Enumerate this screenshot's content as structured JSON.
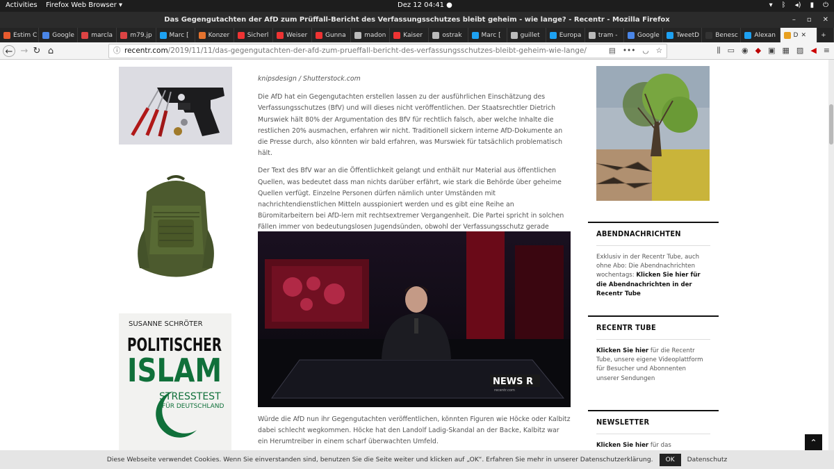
{
  "system": {
    "activities": "Activities",
    "app": "Firefox Web Browser ▾",
    "clock": "Dez 12  04:41 ●"
  },
  "window": {
    "title": "Das Gegengutachten der AfD zum Prüffall-Bericht des Verfassungsschutzes bleibt geheim - wie lange? - Recentr - Mozilla Firefox"
  },
  "tabs": [
    {
      "label": "Estim C",
      "color": "#e85a2e"
    },
    {
      "label": "Google",
      "color": "#4a86e8"
    },
    {
      "label": "marcla",
      "color": "#d44"
    },
    {
      "label": "m79.jp",
      "color": "#d44"
    },
    {
      "label": "Marc [",
      "color": "#1da1f2"
    },
    {
      "label": "Konzer",
      "color": "#e5732e"
    },
    {
      "label": "Sicherl",
      "color": "#e33"
    },
    {
      "label": "Weiser",
      "color": "#e33"
    },
    {
      "label": "Gunna",
      "color": "#e33"
    },
    {
      "label": "madon",
      "color": "#bbb"
    },
    {
      "label": "Kaiser",
      "color": "#e33"
    },
    {
      "label": "ostrak",
      "color": "#bbb"
    },
    {
      "label": "Marc [",
      "color": "#1da1f2"
    },
    {
      "label": "guillet",
      "color": "#bbb"
    },
    {
      "label": "Europa",
      "color": "#1da1f2"
    },
    {
      "label": "tram -",
      "color": "#bbb"
    },
    {
      "label": "Google",
      "color": "#4a86e8"
    },
    {
      "label": "TweetD",
      "color": "#1da1f2"
    },
    {
      "label": "Benesc",
      "color": "#333"
    },
    {
      "label": "Alexan",
      "color": "#1da1f2"
    },
    {
      "label": "D",
      "color": "#e8a020"
    }
  ],
  "url": {
    "domain": "recentr.com",
    "path": "/2019/11/11/das-gegengutachten-der-afd-zum-prueffall-bericht-des-verfassungsschutzes-bleibt-geheim-wie-lange/"
  },
  "article": {
    "caption": "knipsdesign / Shutterstock.com",
    "p1": "Die AfD hat ein Gegengutachten erstellen lassen zu der ausführlichen Einschätzung des Verfassungsschutzes (BfV) und will dieses nicht veröffentlichen. Der Staatsrechtler Dietrich Murswiek hält 80% der Argumentation des BfV für rechtlich falsch, aber welche Inhalte die restlichen 20% ausmachen, erfahren wir nicht. Traditionell sickern interne AfD-Dokumente an die Presse durch, also könnten wir bald erfahren, was Murswiek für tatsächlich problematisch hält.",
    "p2": "Der Text des BfV war an die Öffentlichkeit gelangt und enthält nur Material aus öffentlichen Quellen, was bedeutet dass man nichts darüber erfährt, wie stark die Behörde über geheime Quellen verfügt. Einzelne Personen dürfen nämlich unter Umständen mit nachrichtendienstlichen Mitteln ausspioniert werden und es gibt eine Reihe an Büromitarbeitern bei AfD-lern mit rechtsextremer Vergangenheit. Die Partei spricht in solchen Fällen immer von bedeutungslosen Jugendsünden, obwohl der Verfassungsschutz gerade solche Jugendsünden gerne ausnutzt.",
    "p3": "Würde die AfD nun ihr Gegengutachten veröffentlichen, könnten Figuren wie Höcke oder Kalbitz dabei schlecht wegkommen. Höcke hat den Landolf Ladig-Skandal an der Backe, Kalbitz war ein Herumtreiber in einem scharf überwachten Umfeld.",
    "video_logo": "NEWS R",
    "video_logo_sub": "recentr.com"
  },
  "book": {
    "author": "SUSANNE SCHRÖTER",
    "title1": "POLITISCHER",
    "title2": "ISLAM",
    "sub1": "STRESSTEST",
    "sub2": "FÜR DEUTSCHLAND"
  },
  "sidebar": {
    "w1_title": "ABENDNACHRICHTEN",
    "w1_text": "Exklusiv in der Recentr Tube, auch ohne Abo: Die Abendnachrichten wochentags: ",
    "w1_link": "Klicken Sie hier für die Abendnachrichten in der Recentr Tube",
    "w2_title": "RECENTR TUBE",
    "w2_link": "Klicken Sie hier",
    "w2_text": " für die Recentr Tube, unsere eigene Videoplattform für Besucher und Abonnenten unserer Sendungen",
    "w3_title": "NEWSLETTER",
    "w3_link": "Klicken Sie hier",
    "w3_text": " für das Anmeldeformular"
  },
  "cookie": {
    "text": "Diese Webseite verwendet Cookies. Wenn Sie einverstanden sind, benutzen Sie die Seite weiter und klicken auf „OK“. Erfahren Sie mehr in unserer Datenschutzerklärung.",
    "ok": "OK",
    "privacy": "Datenschutz"
  }
}
